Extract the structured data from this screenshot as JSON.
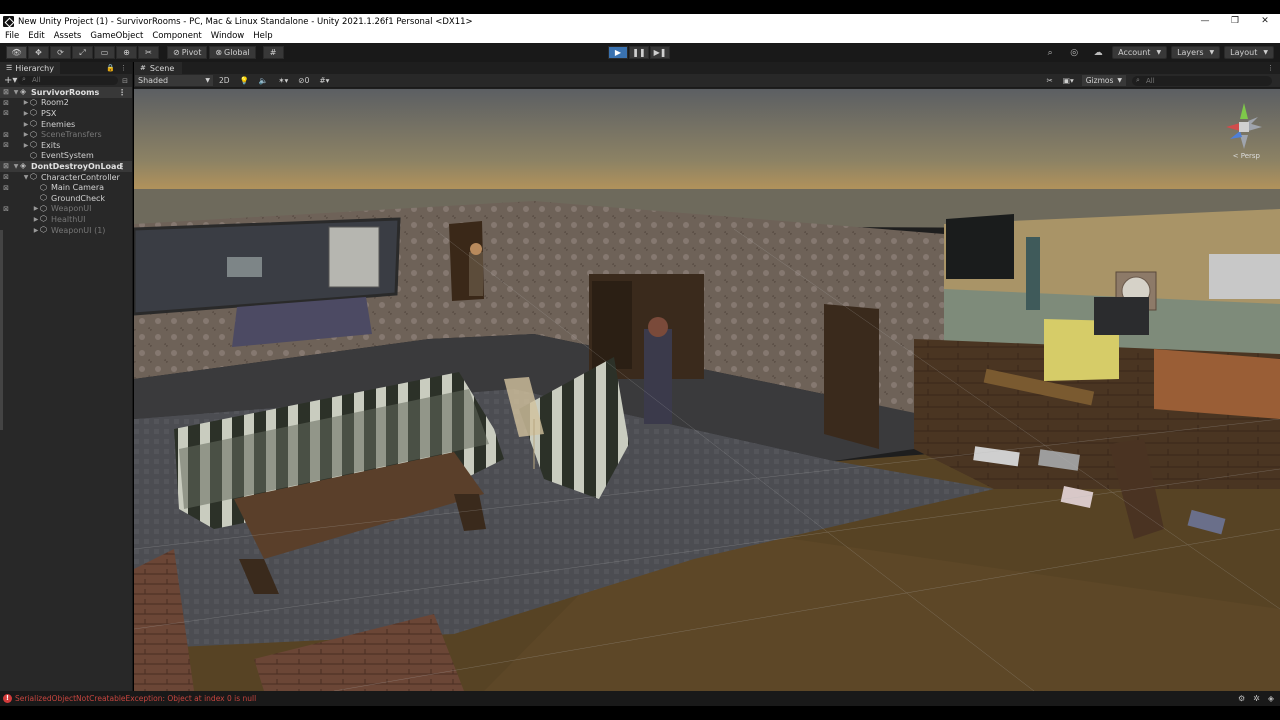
{
  "window": {
    "title": "New Unity Project (1) - SurvivorRooms - PC, Mac & Linux Standalone - Unity 2021.1.26f1 Personal <DX11>",
    "minimize": "—",
    "maximize": "❐",
    "close": "✕"
  },
  "menu": [
    "File",
    "Edit",
    "Assets",
    "GameObject",
    "Component",
    "Window",
    "Help"
  ],
  "toolbar": {
    "pivot_label": "Pivot",
    "global_label": "Global",
    "account_label": "Account",
    "layers_label": "Layers",
    "layout_label": "Layout"
  },
  "hierarchy": {
    "tab_label": "Hierarchy",
    "search_placeholder": "All",
    "rows": [
      {
        "label": "SurvivorRooms",
        "depth": 0,
        "kind": "scene"
      },
      {
        "label": "Room2",
        "depth": 1,
        "kind": "obj"
      },
      {
        "label": "PSX",
        "depth": 1,
        "kind": "obj"
      },
      {
        "label": "Enemies",
        "depth": 1,
        "kind": "obj"
      },
      {
        "label": "SceneTransfers",
        "depth": 1,
        "kind": "dim"
      },
      {
        "label": "Exits",
        "depth": 1,
        "kind": "obj"
      },
      {
        "label": "EventSystem",
        "depth": 1,
        "kind": "obj"
      },
      {
        "label": "DontDestroyOnLoad",
        "depth": 0,
        "kind": "scene"
      },
      {
        "label": "CharacterController",
        "depth": 1,
        "kind": "obj"
      },
      {
        "label": "Main Camera",
        "depth": 2,
        "kind": "obj"
      },
      {
        "label": "GroundCheck",
        "depth": 2,
        "kind": "obj"
      },
      {
        "label": "WeaponUI",
        "depth": 2,
        "kind": "dim"
      },
      {
        "label": "HealthUI",
        "depth": 2,
        "kind": "dim"
      },
      {
        "label": "WeaponUI (1)",
        "depth": 2,
        "kind": "dim"
      }
    ]
  },
  "scene": {
    "tab_label": "Scene",
    "shading_mode": "Shaded",
    "mode_2d": "2D",
    "fx_count": "0",
    "gizmos_label": "Gizmos",
    "search_placeholder": "All",
    "projection_label": "< Persp"
  },
  "status": {
    "error_message": "SerializedObjectNotCreatableException: Object at index 0 is null"
  },
  "colors": {
    "accent_play": "#3a72b0",
    "error": "#c6453f",
    "panel_bg": "#282828"
  }
}
